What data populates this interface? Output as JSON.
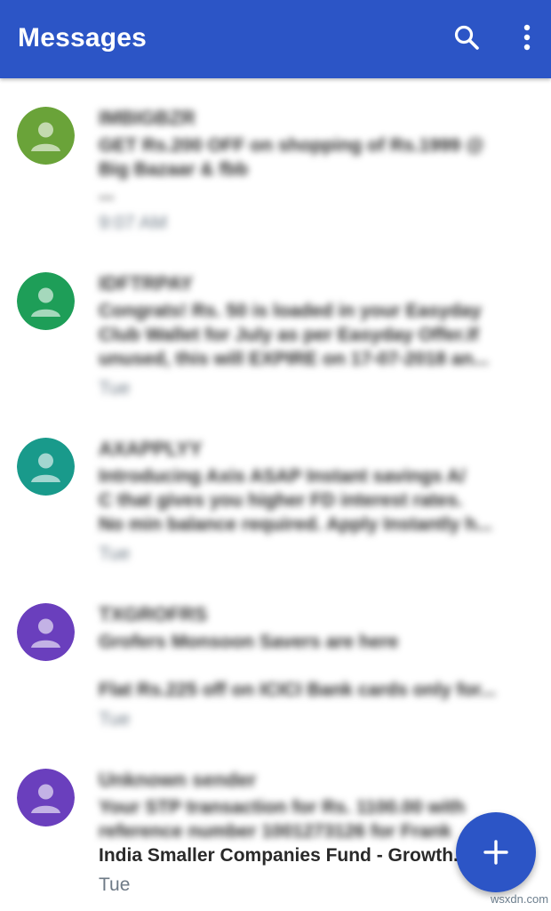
{
  "appbar": {
    "title": "Messages",
    "search_icon": "search-icon",
    "menu_icon": "more-vert-icon",
    "color": "#2c55c6"
  },
  "conversations": [
    {
      "sender": "IMBIGBZR",
      "lines": [
        "GET Rs.200 OFF on shopping of Rs.1999 @",
        "Big Bazaar & fbb",
        "..."
      ],
      "time": "9:07 AM",
      "avatar_color": "#6aa339"
    },
    {
      "sender": "IDFTRPAY",
      "lines": [
        "Congrats! Rs. 50 is loaded in your Easyday",
        "Club Wallet for July as per Easyday Offer.If",
        "unused, this will EXPIRE on 17-07-2018 an..."
      ],
      "time": "Tue",
      "avatar_color": "#1e9e58"
    },
    {
      "sender": "AXAPPLYY",
      "lines": [
        "Introducing Axis ASAP Instant savings A/",
        "C that gives you higher FD interest rates.",
        "No min balance required.  Apply Instantly h..."
      ],
      "time": "Tue",
      "avatar_color": "#199a8b"
    },
    {
      "sender": "TXGROFRS",
      "lines": [
        "Grofers Monsoon Savers are here",
        "",
        "Flat Rs.225 off on ICICI Bank cards only for..."
      ],
      "time": "Tue",
      "avatar_color": "#6a3fbd"
    },
    {
      "sender": "Unknown sender",
      "lines": [
        "Your STP transaction for Rs. 1100.00 with",
        "reference number 1001273126 for Frank",
        "India Smaller Companies Fund - Growth..."
      ],
      "time": "Tue",
      "avatar_color": "#6a3fbd"
    }
  ],
  "fab": {
    "icon": "add-icon",
    "label": "+"
  },
  "watermark": "wsxdn.com"
}
